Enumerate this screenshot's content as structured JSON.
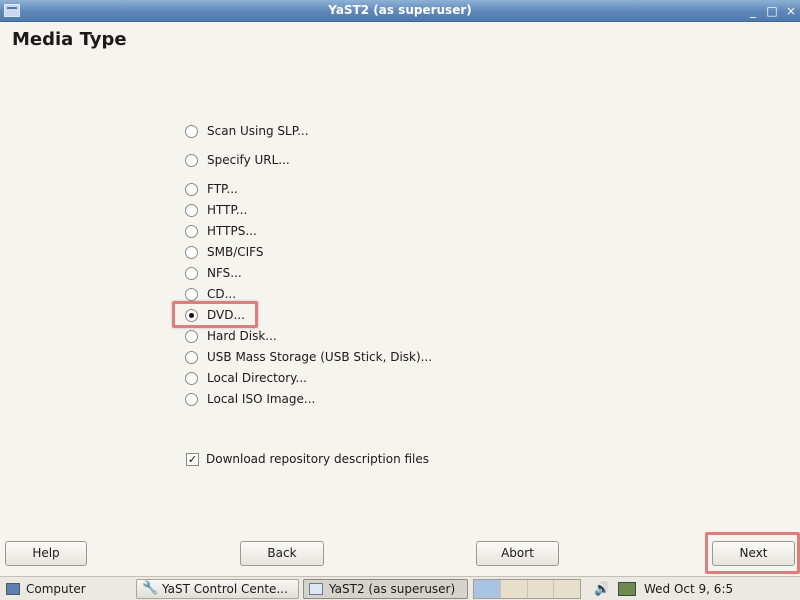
{
  "window": {
    "title": "YaST2 (as superuser)",
    "controls": [
      "minimize-icon",
      "maximize-icon",
      "close-icon"
    ]
  },
  "page": {
    "title": "Media Type"
  },
  "media_options": [
    {
      "label": "Scan Using SLP...",
      "checked": false
    },
    {
      "label": "Specify URL...",
      "checked": false
    },
    {
      "label": "FTP...",
      "checked": false
    },
    {
      "label": "HTTP...",
      "checked": false
    },
    {
      "label": "HTTPS...",
      "checked": false
    },
    {
      "label": "SMB/CIFS",
      "checked": false
    },
    {
      "label": "NFS...",
      "checked": false
    },
    {
      "label": "CD...",
      "checked": false
    },
    {
      "label": "DVD...",
      "checked": true
    },
    {
      "label": "Hard Disk...",
      "checked": false
    },
    {
      "label": "USB Mass Storage (USB Stick, Disk)...",
      "checked": false
    },
    {
      "label": "Local Directory...",
      "checked": false
    },
    {
      "label": "Local ISO Image...",
      "checked": false
    }
  ],
  "download_checkbox": {
    "label": "Download repository description files",
    "checked": true
  },
  "buttons": {
    "help": "Help",
    "back": "Back",
    "abort": "Abort",
    "next": "Next"
  },
  "taskbar": {
    "computer": "Computer",
    "task1": "YaST Control Cente...",
    "task2": "YaST2 (as superuser)",
    "clock": "Wed Oct  9,  6:5"
  },
  "colors": {
    "title_bar": "#5d87b8",
    "highlight": "#e07c7c",
    "background": "#f6f4ef"
  }
}
